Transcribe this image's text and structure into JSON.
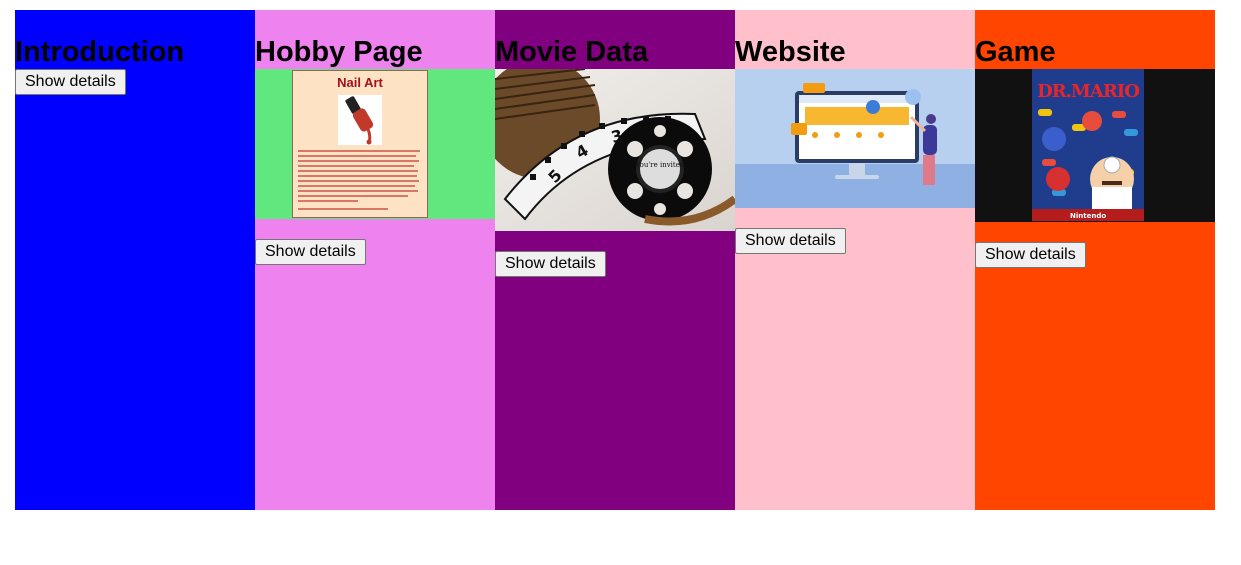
{
  "cards": [
    {
      "title": "Introduction",
      "color": "#0000ff",
      "button": "Show details"
    },
    {
      "title": "Hobby Page",
      "color": "#ee82ee",
      "button": "Show details",
      "image": {
        "title": "Nail Art"
      }
    },
    {
      "title": "Movie Data",
      "color": "#800080",
      "button": "Show details",
      "image": {
        "caption": "You're invited"
      }
    },
    {
      "title": "Website",
      "color": "#ffc0cb",
      "button": "Show details"
    },
    {
      "title": "Game",
      "color": "#ff4500",
      "button": "Show details",
      "image": {
        "logo": "DR.MARIO",
        "brand": "Nintendo"
      }
    }
  ]
}
